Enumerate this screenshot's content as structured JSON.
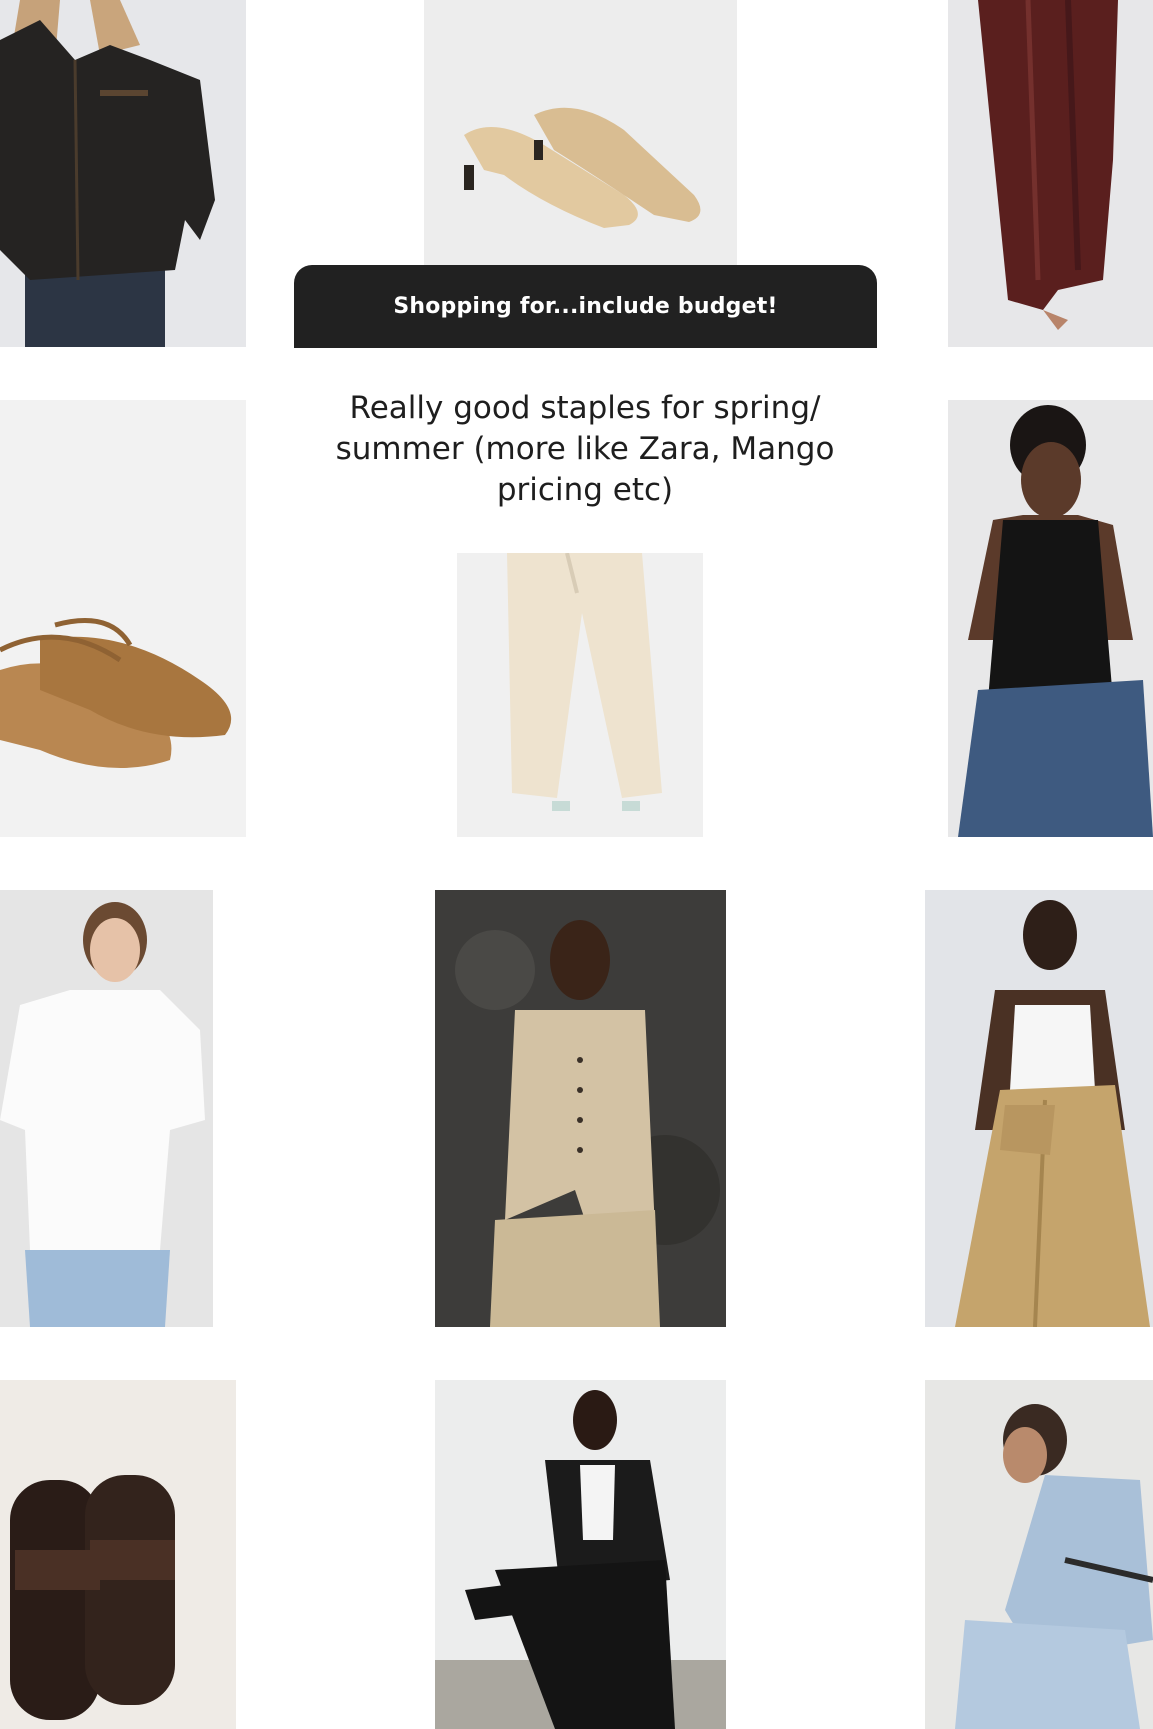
{
  "question": {
    "prompt": "Shopping for...include budget!",
    "answer": "Really good staples for spring/ summer (more like Zara, Mango pricing etc)"
  },
  "grid_tiles": [
    {
      "name": "leather-jacket-photo"
    },
    {
      "name": "kitten-heel-mules-photo"
    },
    {
      "name": "burgundy-satin-skirt-photo"
    },
    {
      "name": "mesh-ballet-flats-photo"
    },
    {
      "name": "linen-trousers-photo"
    },
    {
      "name": "black-tank-top-photo"
    },
    {
      "name": "white-tshirt-photo"
    },
    {
      "name": "beige-waistcoat-photo"
    },
    {
      "name": "wrap-skirt-photo"
    },
    {
      "name": "brown-sandals-photo"
    },
    {
      "name": "black-outfit-photo"
    },
    {
      "name": "denim-shirt-photo"
    }
  ],
  "colors": {
    "background": "#ffffff",
    "banner": "#212121",
    "banner_text": "#ffffff",
    "answer_text": "#1e1e1e"
  }
}
